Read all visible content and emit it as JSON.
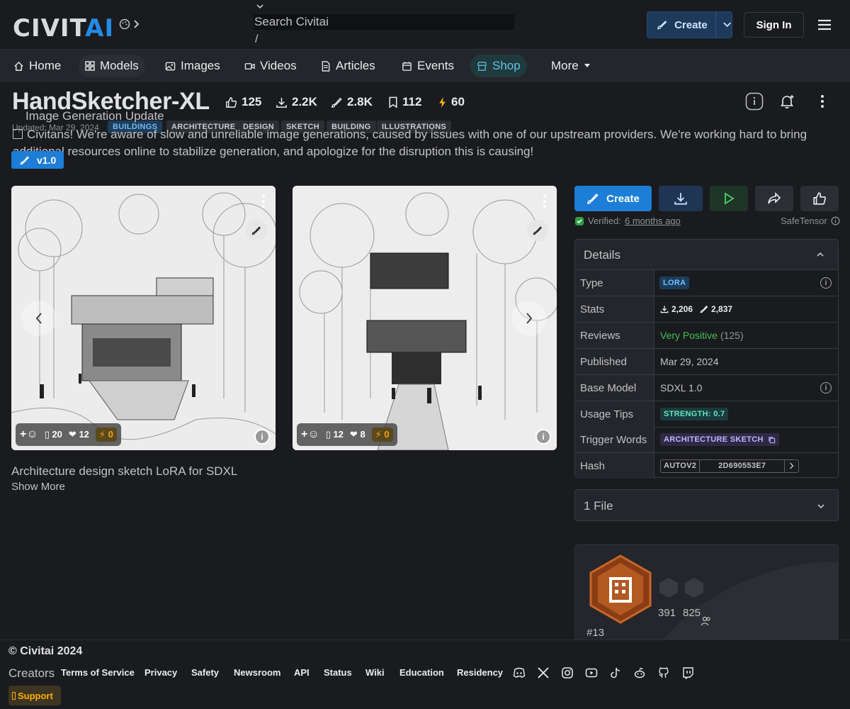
{
  "header": {
    "logo_main": "CIVIT",
    "logo_accent": "AI",
    "search_placeholder": "Search Civitai",
    "search_shortcut": "/",
    "create_label": "Create",
    "signin_label": "Sign In"
  },
  "nav": {
    "items": [
      {
        "label": "Home",
        "icon": "home-icon"
      },
      {
        "label": "Models",
        "icon": "models-icon"
      },
      {
        "label": "Images",
        "icon": "images-icon"
      },
      {
        "label": "Videos",
        "icon": "videos-icon"
      },
      {
        "label": "Articles",
        "icon": "articles-icon"
      },
      {
        "label": "Events",
        "icon": "events-icon"
      },
      {
        "label": "Shop",
        "icon": "shop-icon"
      },
      {
        "label": "More",
        "icon": "caret-down-icon"
      }
    ]
  },
  "model": {
    "title": "HandSketcher-XL",
    "stats": {
      "likes": "125",
      "downloads": "2.2K",
      "generations": "2.8K",
      "bookmarks": "112",
      "buzz": "60"
    },
    "updated": "Updated: Mar 29, 2024",
    "tags": [
      "BUILDINGS",
      "ARCHITECTURE",
      "DESIGN",
      "SKETCH",
      "BUILDING",
      "ILLUSTRATIONS"
    ],
    "version": "v1.0",
    "description": "Architecture design sketch LoRA for SDXL",
    "show_more": "Show More"
  },
  "banner": {
    "title": "Image Generation Update",
    "text": "Civitans! We're aware of slow and unreliable image generations, caused by issues with one of our upstream providers. We're working hard to bring additional resources online to stabilize generation, and apologize for the disruption this is causing!"
  },
  "images": [
    {
      "comments": "20",
      "likes": "12",
      "buzz": "0"
    },
    {
      "comments": "12",
      "likes": "8",
      "buzz": "0"
    }
  ],
  "actions": {
    "create_label": "Create",
    "verified_label": "Verified:",
    "verified_when": "6 months ago",
    "format": "SafeTensor"
  },
  "details": {
    "heading": "Details",
    "rows": {
      "type_label": "Type",
      "type_value": "LORA",
      "stats_label": "Stats",
      "stats_downloads": "2,206",
      "stats_generations": "2,837",
      "reviews_label": "Reviews",
      "reviews_value": "Very Positive",
      "reviews_count": "(125)",
      "published_label": "Published",
      "published_value": "Mar 29, 2024",
      "base_label": "Base Model",
      "base_value": "SDXL 1.0",
      "tips_label": "Usage Tips",
      "tips_value": "STRENGTH: 0.7",
      "trigger_label": "Trigger Words",
      "trigger_value": "ARCHITECTURE SKETCH",
      "hash_label": "Hash",
      "hash_type": "AUTOV2",
      "hash_value": "2D690553E7"
    }
  },
  "files": {
    "label": "1 File"
  },
  "creator": {
    "rank": "#13",
    "stat_a": "391",
    "stat_b": "825"
  },
  "footer": {
    "copyright": "© Civitai 2024",
    "creators": "Creators",
    "links": [
      "Terms of Service",
      "Privacy",
      "Safety",
      "Newsroom",
      "API",
      "Status",
      "Wiki",
      "Education",
      "Residency"
    ],
    "support": "Support"
  },
  "colors": {
    "accent": "#228be6",
    "positive": "#40c057",
    "buzz": "#fab005",
    "background": "#1a1b1e"
  }
}
